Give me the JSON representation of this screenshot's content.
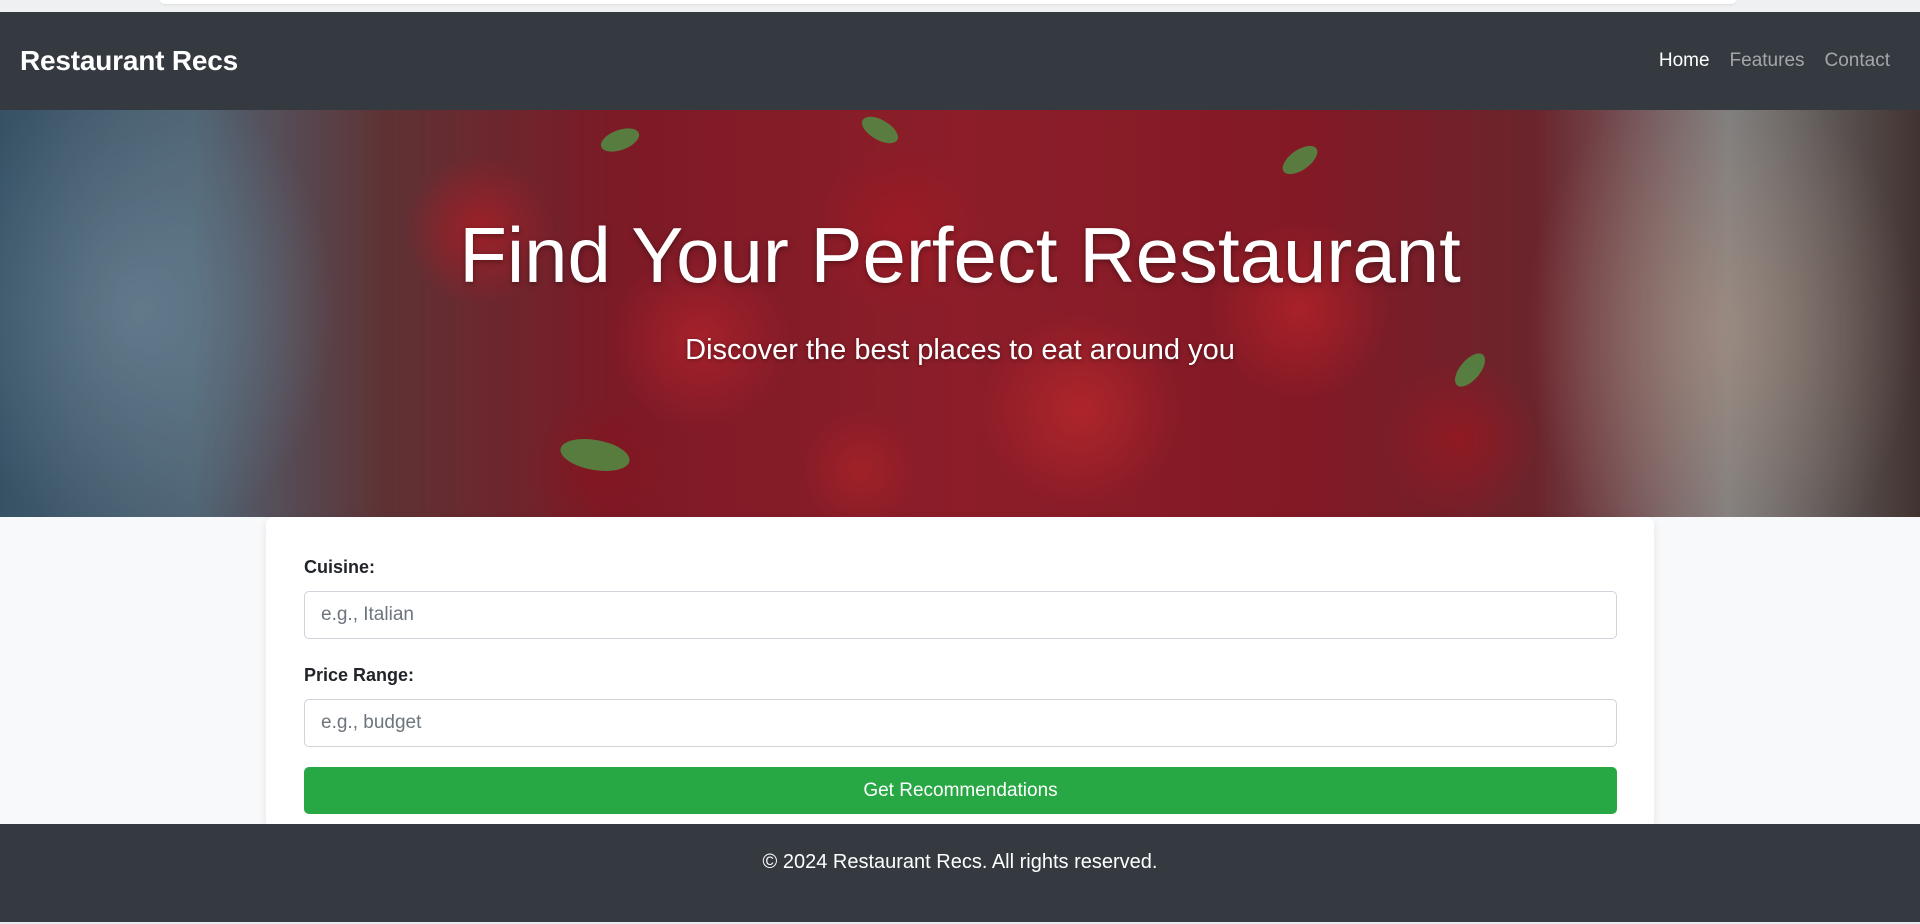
{
  "navbar": {
    "brand": "Restaurant Recs",
    "links": [
      {
        "label": "Home",
        "active": true
      },
      {
        "label": "Features",
        "active": false
      },
      {
        "label": "Contact",
        "active": false
      }
    ]
  },
  "hero": {
    "title": "Find Your Perfect Restaurant",
    "subtitle": "Discover the best places to eat around you"
  },
  "form": {
    "cuisine_label": "Cuisine:",
    "cuisine_placeholder": "e.g., Italian",
    "cuisine_value": "",
    "price_label": "Price Range:",
    "price_placeholder": "e.g., budget",
    "price_value": "",
    "submit_label": "Get Recommendations"
  },
  "footer": {
    "text": "© 2024 Restaurant Recs. All rights reserved."
  },
  "colors": {
    "navbar_bg": "#343a40",
    "accent_button": "#28a745",
    "page_bg": "#f8f9fa"
  }
}
